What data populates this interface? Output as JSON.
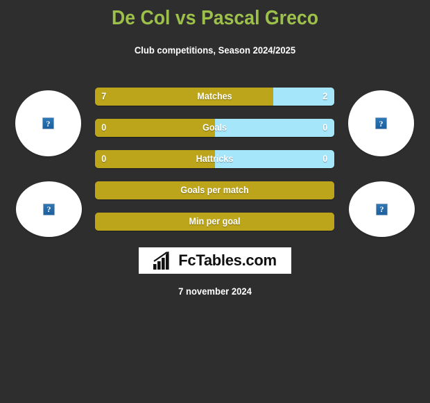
{
  "header": {
    "title": "De Col vs Pascal Greco",
    "subtitle": "Club competitions, Season 2024/2025",
    "title_color": "#9cc04a",
    "subtitle_color": "#ffffff"
  },
  "theme": {
    "background": "#2e2e2e",
    "home_color": "#bca51a",
    "away_color": "#a5e6fb",
    "logo_background": "#ffffff",
    "logo_text_color": "#111111"
  },
  "avatars": [
    {
      "name": "home-player-photo",
      "placeholder": "?",
      "position": "left-top"
    },
    {
      "name": "away-player-photo",
      "placeholder": "?",
      "position": "right-top"
    },
    {
      "name": "home-club-logo",
      "placeholder": "?",
      "position": "left-bottom"
    },
    {
      "name": "away-club-logo",
      "placeholder": "?",
      "position": "right-bottom"
    }
  ],
  "stats": [
    {
      "label": "Matches",
      "home": "7",
      "away": "2",
      "home_percent": 74.5,
      "show_values": true
    },
    {
      "label": "Goals",
      "home": "0",
      "away": "0",
      "home_percent": 50,
      "show_values": true
    },
    {
      "label": "Hattricks",
      "home": "0",
      "away": "0",
      "home_percent": 50,
      "show_values": true
    },
    {
      "label": "Goals per match",
      "home": "",
      "away": "",
      "home_percent": 100,
      "show_values": false
    },
    {
      "label": "Min per goal",
      "home": "",
      "away": "",
      "home_percent": 100,
      "show_values": false
    }
  ],
  "logo": {
    "text": "FcTables.com",
    "icon": "bar-chart-growth-icon"
  },
  "footer": {
    "date": "7 november 2024"
  }
}
